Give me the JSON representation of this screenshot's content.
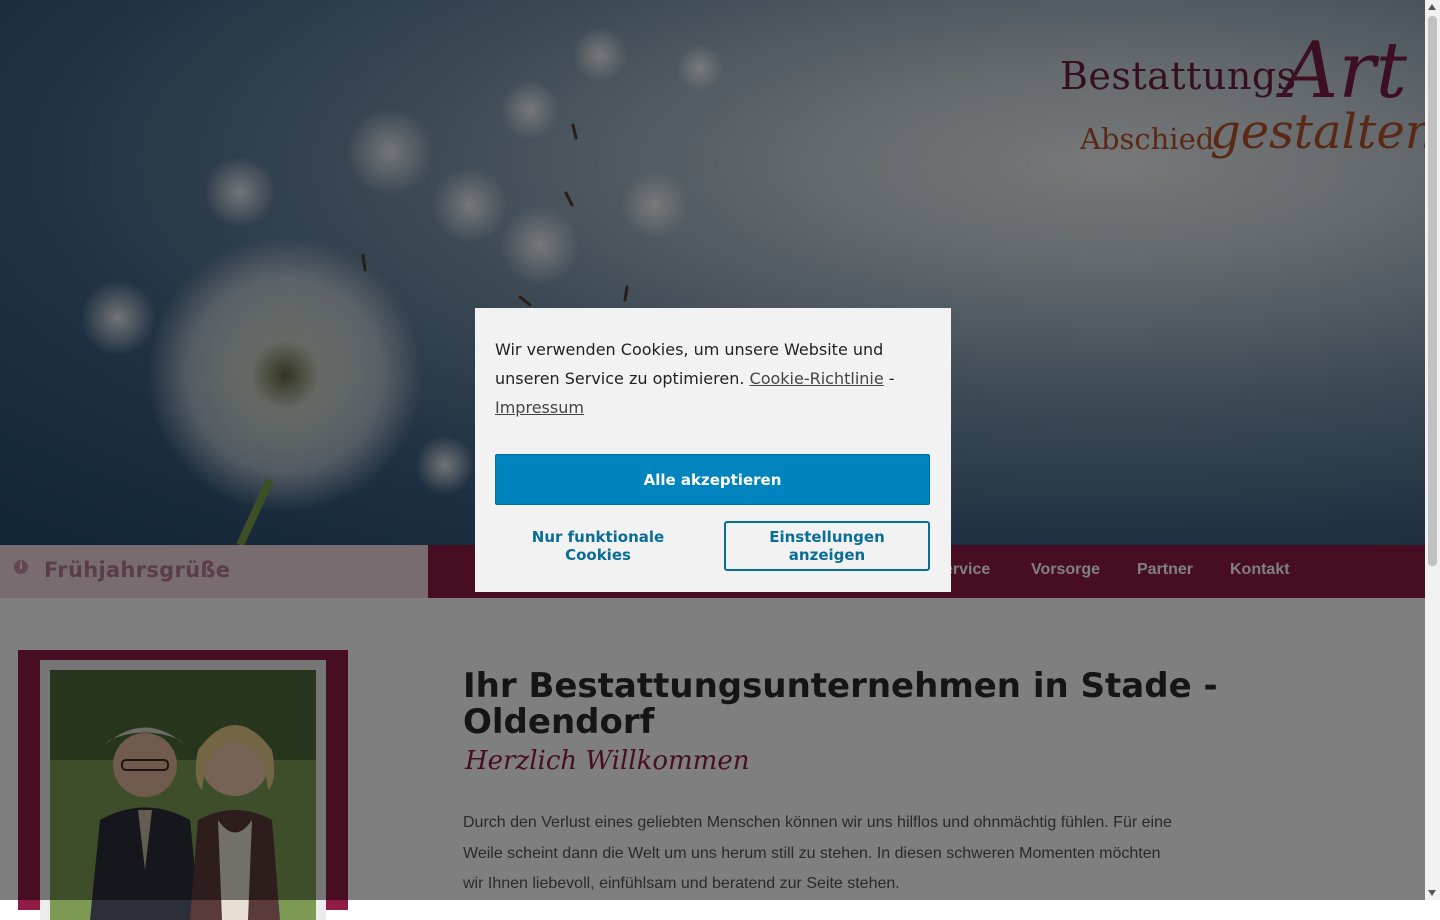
{
  "logo": {
    "main": "Bestattungs",
    "art": "Art",
    "sub": "Abschied",
    "script": "gestalten"
  },
  "ticker": {
    "icon": "info-icon",
    "text": "Frühjahrsgrüße"
  },
  "nav": {
    "items": [
      {
        "label": "ervice"
      },
      {
        "label": "Vorsorge"
      },
      {
        "label": "Partner"
      },
      {
        "label": "Kontakt"
      }
    ]
  },
  "main": {
    "heading": "Ihr Bestattungsunternehmen in Stade - Oldendorf",
    "subheading": "Herzlich Willkommen",
    "body": "Durch den Verlust eines geliebten Menschen können wir uns hilflos und ohnmächtig fühlen. Für eine Weile scheint dann die Welt um uns herum still zu stehen. In diesen schweren Momenten möchten wir Ihnen liebevoll, einfühlsam und beratend zur Seite stehen."
  },
  "cookie": {
    "message": "Wir verwenden Cookies, um unsere Website und unseren Service zu optimieren.",
    "policy_link": "Cookie-Richtlinie",
    "separator": "-",
    "imprint_link": "Impressum",
    "accept_all": "Alle akzeptieren",
    "functional_only": "Nur funktionale Cookies",
    "show_settings": "Einstellungen anzeigen"
  },
  "colors": {
    "brand": "#8f1c46",
    "accent": "#0084bd",
    "link": "#0a6d98"
  }
}
